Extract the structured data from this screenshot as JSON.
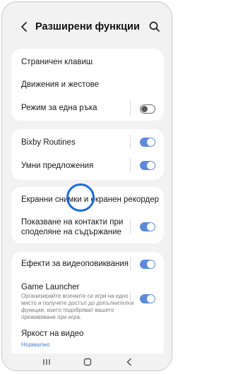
{
  "header": {
    "title": "Разширени функции",
    "back_icon": "chevron-left-icon",
    "search_icon": "search-icon"
  },
  "group1": {
    "items": [
      {
        "label": "Страничен клавиш"
      },
      {
        "label": "Движения и жестове"
      },
      {
        "label": "Режим за една ръка",
        "toggle": false
      }
    ]
  },
  "group2": {
    "items": [
      {
        "label": "Bixby Routines",
        "toggle": true
      },
      {
        "label": "Умни предложения",
        "toggle": true
      }
    ]
  },
  "group3": {
    "items": [
      {
        "label": "Екранни снимки и екранен рекордер"
      },
      {
        "label": "Показване на контакти при споделяне на съдържание",
        "line1": "Показване на контакти при",
        "line2": "споделяне на съдържание",
        "toggle": true
      }
    ]
  },
  "group4": {
    "items": [
      {
        "label": "Ефекти за видеоповиквания",
        "toggle": true
      },
      {
        "label": "Game Launcher",
        "description": "Организирайте всичките си игри на едно място и получете достъп до допълнителни функции, които подобряват вашето преживяване при игра.",
        "toggle": true
      },
      {
        "label": "Яркост на видео",
        "value": "Нормално"
      }
    ]
  },
  "colors": {
    "accent": "#5d8ad9",
    "highlight": "#1a6dde",
    "background": "#f2f2f2"
  },
  "navbar": {
    "icons": [
      "recent-apps-icon",
      "home-icon",
      "back-icon"
    ]
  }
}
